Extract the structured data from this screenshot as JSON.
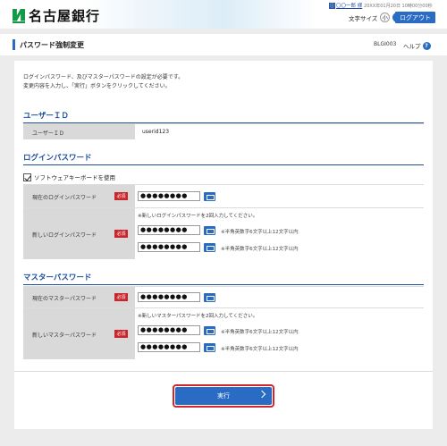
{
  "header": {
    "bank_name": "名古屋銀行",
    "user_badge": "ⓘ",
    "user_name": "〇〇一郎 様",
    "datetime": "20XX年01月20日 10時00分00秒",
    "font_size_label": "文字サイズ",
    "font_sizes": [
      "小",
      "中",
      "大"
    ],
    "logout_label": "ログアウト"
  },
  "titlebar": {
    "title": "パスワード強制変更",
    "screen_code": "BLGI003",
    "help_label": "ヘルプ",
    "help_icon": "?"
  },
  "intro": {
    "line1": "ログインパスワード、及びマスターパスワードの設定が必要です。",
    "line2": "変更内容を入力し、「実行」ボタンをクリックしてください。"
  },
  "user_id_section": {
    "heading": "ユーザーＩＤ",
    "label": "ユーザーＩＤ",
    "value": "userid123"
  },
  "login_pw_section": {
    "heading": "ログインパスワード",
    "software_keyboard_label": "ソフトウェアキーボードを使用",
    "current_label": "現在のログインパスワード",
    "new_label": "新しいログインパスワード",
    "required": "必須",
    "new_note": "※新しいログインパスワードを2回入力してください。",
    "hint": "※半角英数字6文字以上12文字以内",
    "mask": "●●●●●●●●"
  },
  "master_pw_section": {
    "heading": "マスターパスワード",
    "current_label": "現在のマスターパスワード",
    "new_label": "新しいマスターパスワード",
    "required": "必須",
    "new_note": "※新しいマスターパスワードを2回入力してください。",
    "hint": "※半角英数字6文字以上12文字以内",
    "mask": "●●●●●●●●"
  },
  "exec_button_label": "実行"
}
